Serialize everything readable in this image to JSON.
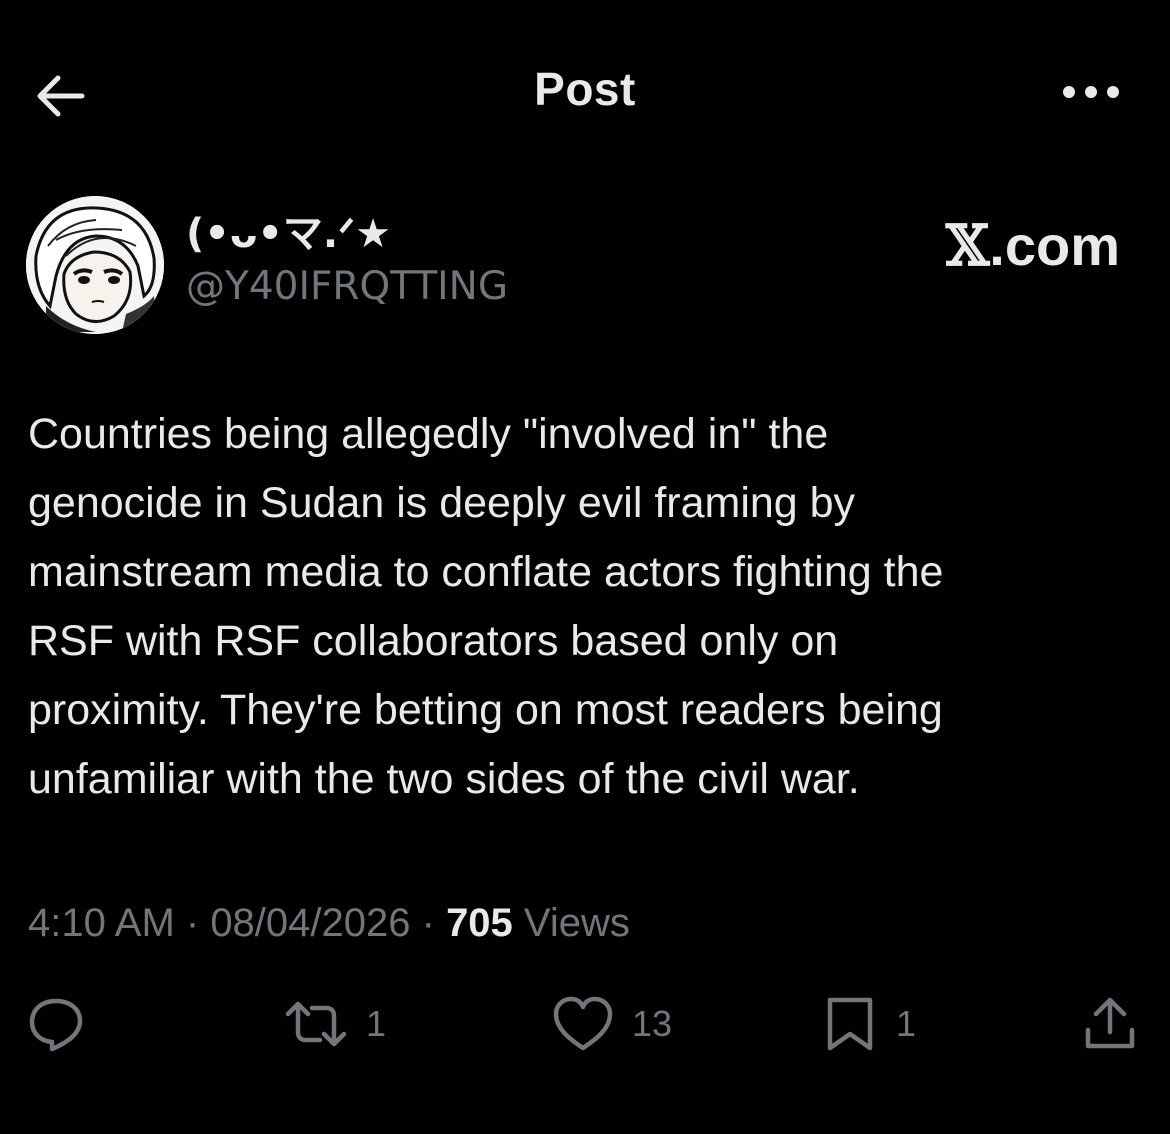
{
  "header": {
    "title": "Post",
    "back_icon": "arrow-left-icon",
    "more_icon": "more-horizontal-icon"
  },
  "author": {
    "display_name": "(•ᴗ•マ.ᐟ★",
    "handle": "@Y40IFRQTTING",
    "avatar_icon": "avatar-image"
  },
  "watermark": {
    "x_glyph": "𝕏",
    "domain": ".com"
  },
  "post": {
    "text": "Countries being allegedly \"involved in\" the\ngenocide in Sudan is deeply evil framing by\nmainstream media to conflate actors fighting the\nRSF with RSF collaborators based only on\nproximity. They're betting on most readers being\nunfamiliar with the two sides of the civil war."
  },
  "meta": {
    "time": "4:10 AM",
    "sep1": " · ",
    "date": "08/04/2026",
    "sep2": " · ",
    "views_count": "705",
    "views_label": " Views"
  },
  "actions": {
    "reply": {
      "icon": "reply-icon",
      "count": ""
    },
    "repost": {
      "icon": "repost-icon",
      "count": "1"
    },
    "like": {
      "icon": "heart-icon",
      "count": "13"
    },
    "bookmark": {
      "icon": "bookmark-icon",
      "count": "1"
    },
    "share": {
      "icon": "share-icon",
      "count": ""
    }
  },
  "colors": {
    "background": "#000000",
    "primary_text": "#e7e9ea",
    "secondary_text": "#71767b"
  }
}
